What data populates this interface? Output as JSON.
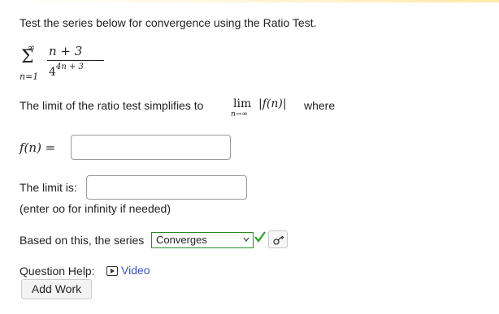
{
  "question": {
    "prompt": "Test the series below for convergence using the Ratio Test.",
    "series": {
      "upper_limit": "∞",
      "sigma": "Σ",
      "index": "n=1",
      "numerator": "n + 3",
      "denominator_base": "4",
      "denominator_exponent": "4n + 3"
    },
    "limit_text": "The limit of the ratio test simplifies to",
    "lim_word": "lim",
    "lim_subscript": "n→∞",
    "abs_expression": "|f(n)|",
    "where_text": "where"
  },
  "fn_field": {
    "label": "f(n) =",
    "value": ""
  },
  "limit_field": {
    "label": "The limit is:",
    "value": "",
    "hint": "(enter oo for infinity if needed)"
  },
  "conclusion": {
    "label": "Based on this, the series",
    "selected": "Converges",
    "status": "correct"
  },
  "help": {
    "label": "Question Help:",
    "video_label": "Video"
  },
  "add_work_label": "Add Work",
  "colors": {
    "select_border": "#2a8a2a",
    "check": "#2a9d2a",
    "link": "#3a4fb8"
  },
  "icons": [
    "play-icon",
    "check-icon",
    "key-icon",
    "caret-down-icon"
  ]
}
